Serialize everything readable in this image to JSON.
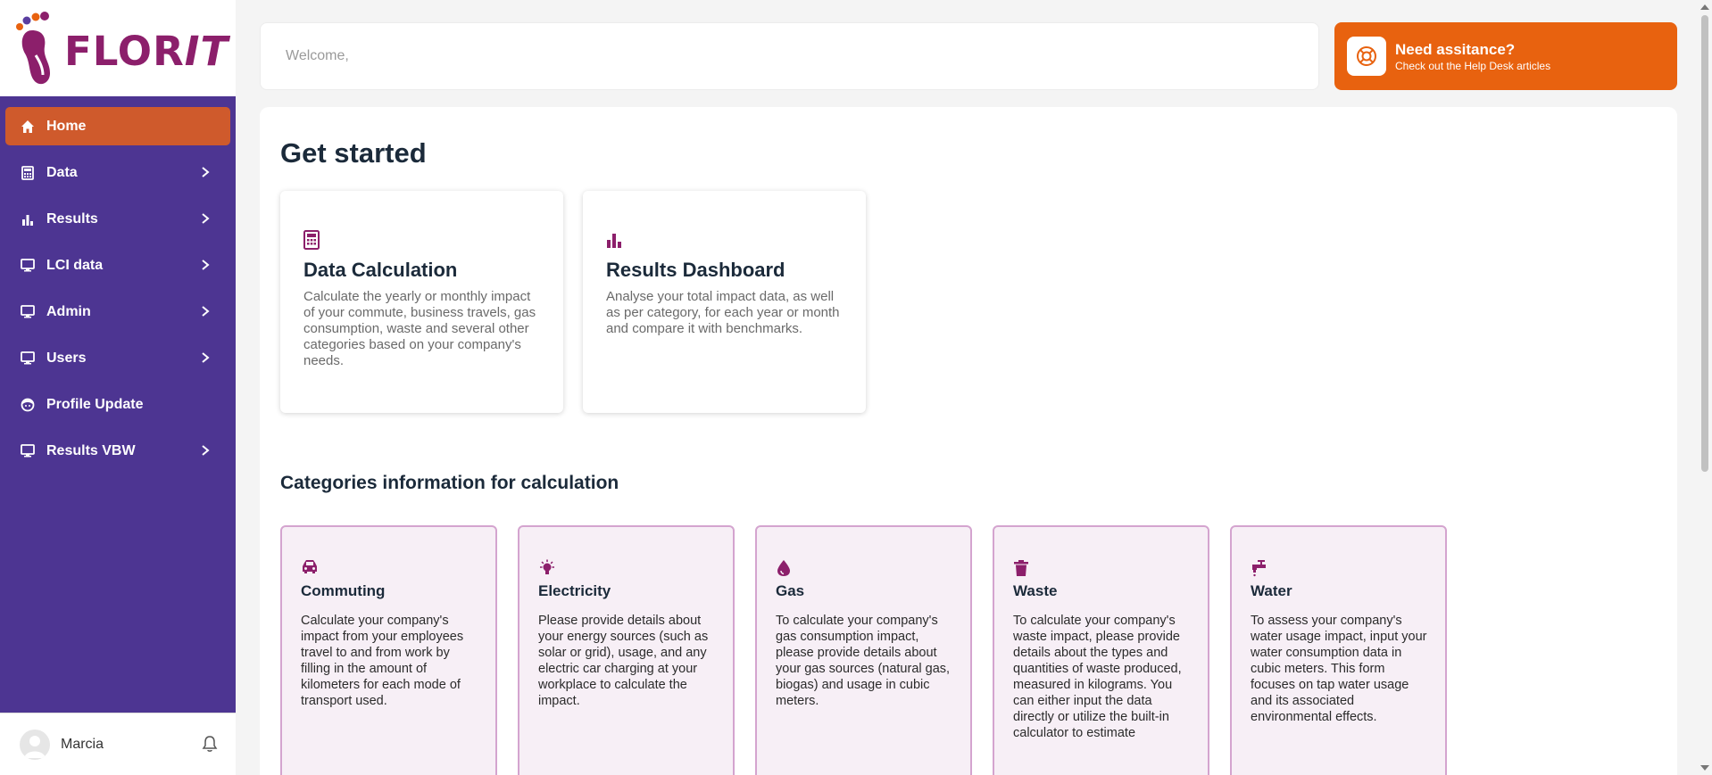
{
  "brand": {
    "logo_text_a": "FLOR",
    "logo_text_b": "IT"
  },
  "sidebar": {
    "items": [
      {
        "label": "Home",
        "icon": "home-icon",
        "active": true
      },
      {
        "label": "Data",
        "icon": "calculator-icon"
      },
      {
        "label": "Results",
        "icon": "bar-chart-icon"
      },
      {
        "label": "LCI data",
        "icon": "monitor-icon"
      },
      {
        "label": "Admin",
        "icon": "monitor-icon"
      },
      {
        "label": "Users",
        "icon": "monitor-icon"
      },
      {
        "label": "Profile Update",
        "icon": "face-icon"
      },
      {
        "label": "Results VBW",
        "icon": "monitor-icon"
      }
    ],
    "user_name": "Marcia"
  },
  "header": {
    "welcome": "Welcome,",
    "help_title": "Need assitance?",
    "help_subtitle": "Check out the Help Desk articles"
  },
  "main": {
    "title": "Get started",
    "cards": [
      {
        "title": "Data Calculation",
        "icon": "calculator-icon",
        "text": "Calculate the yearly or monthly impact of your commute, business travels, gas consumption, waste and several other categories based on your company's needs."
      },
      {
        "title": "Results Dashboard",
        "icon": "bar-chart-icon",
        "text": "Analyse your total impact data, as well as per category, for each year or month and compare it with benchmarks."
      }
    ],
    "categories_title": "Categories information for calculation",
    "categories": [
      {
        "title": "Commuting",
        "icon": "car-icon",
        "text": "Calculate your company's impact from your employees travel to and from work by filling in the amount of kilometers for each mode of transport used."
      },
      {
        "title": "Electricity",
        "icon": "lightbulb-icon",
        "text": "Please provide details about your energy sources (such as solar or grid), usage, and any electric car charging at your workplace to calculate the impact."
      },
      {
        "title": "Gas",
        "icon": "drop-icon",
        "text": "To calculate your company's gas consumption impact, please provide details about your gas sources (natural gas, biogas) and usage in cubic meters."
      },
      {
        "title": "Waste",
        "icon": "trash-icon",
        "text": "To calculate your company's waste impact, please provide details about the types and quantities of waste produced, measured in kilograms. You can either input the data directly or utilize the built-in calculator to estimate"
      },
      {
        "title": "Water",
        "icon": "faucet-icon",
        "text": "To assess your company's water usage impact, input your water consumption data in cubic meters. This form focuses on tap water usage and its associated environmental effects."
      }
    ]
  },
  "colors": {
    "sidebar": "#4d3592",
    "accent": "#e8620f",
    "active": "#cf5a2c",
    "brand": "#8c1f6b",
    "category_bg": "#f7eff6",
    "category_border": "#d4a4cf"
  }
}
